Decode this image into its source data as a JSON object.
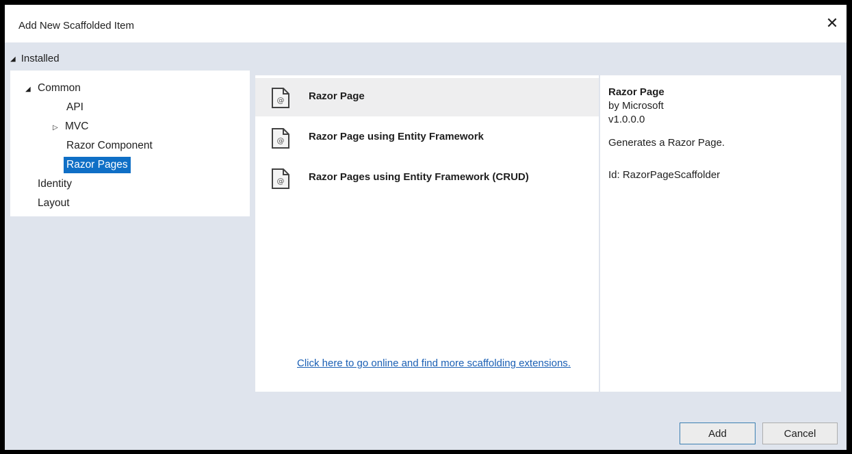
{
  "dialog": {
    "title": "Add New Scaffolded Item",
    "close_glyph": "✕"
  },
  "installed": {
    "label": "Installed"
  },
  "tree": {
    "common": "Common",
    "api": "API",
    "mvc": "MVC",
    "razor_component": "Razor Component",
    "razor_pages": "Razor Pages",
    "identity": "Identity",
    "layout": "Layout"
  },
  "list": {
    "items": [
      {
        "label": "Razor Page",
        "icon": "razor-file-icon"
      },
      {
        "label": "Razor Page using Entity Framework",
        "icon": "razor-file-icon"
      },
      {
        "label": "Razor Pages using Entity Framework (CRUD)",
        "icon": "razor-file-icon"
      }
    ],
    "online_link": "Click here to go online and find more scaffolding extensions."
  },
  "details": {
    "name": "Razor Page",
    "author": "by Microsoft",
    "version": "v1.0.0.0",
    "description": "Generates a Razor Page.",
    "id": "Id: RazorPageScaffolder"
  },
  "buttons": {
    "add": "Add",
    "cancel": "Cancel"
  },
  "colors": {
    "selection": "#0f6fc6",
    "link": "#1a5fb4",
    "dialog_bg": "#dfe4ed"
  }
}
